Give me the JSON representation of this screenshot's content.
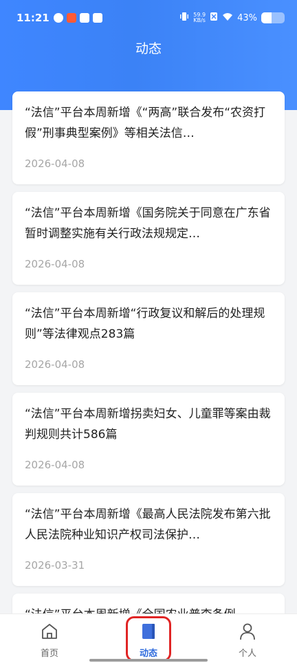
{
  "status": {
    "time": "11:21",
    "netspeed_value": "59.9",
    "netspeed_unit": "KB/s",
    "battery": "43%",
    "battery_level": 0.43
  },
  "header": {
    "title": "动态"
  },
  "feed": [
    {
      "text": "“法信”平台本周新增《“两高”联合发布“农资打假”刑事典型案例》等相关法信…",
      "date": "2026-04-08"
    },
    {
      "text": "“法信”平台本周新增《国务院关于同意在广东省暂时调整实施有关行政法规规定…",
      "date": "2026-04-08"
    },
    {
      "text": "“法信”平台本周新增“行政复议和解后的处理规则”等法律观点283篇",
      "date": "2026-04-08"
    },
    {
      "text": "“法信”平台本周新增拐卖妇女、儿童罪等案由裁判规则共计586篇",
      "date": "2026-04-08"
    },
    {
      "text": "“法信”平台本周新增《最高人民法院发布第六批人民法院种业知识产权司法保护…",
      "date": "2026-03-31"
    },
    {
      "text": "“法信”平台本周新增《全国农业普查条例",
      "date": ""
    }
  ],
  "tabbar": {
    "home_label": "首页",
    "feed_label": "动态",
    "profile_label": "个人",
    "active_color": "#2f6bdc"
  }
}
